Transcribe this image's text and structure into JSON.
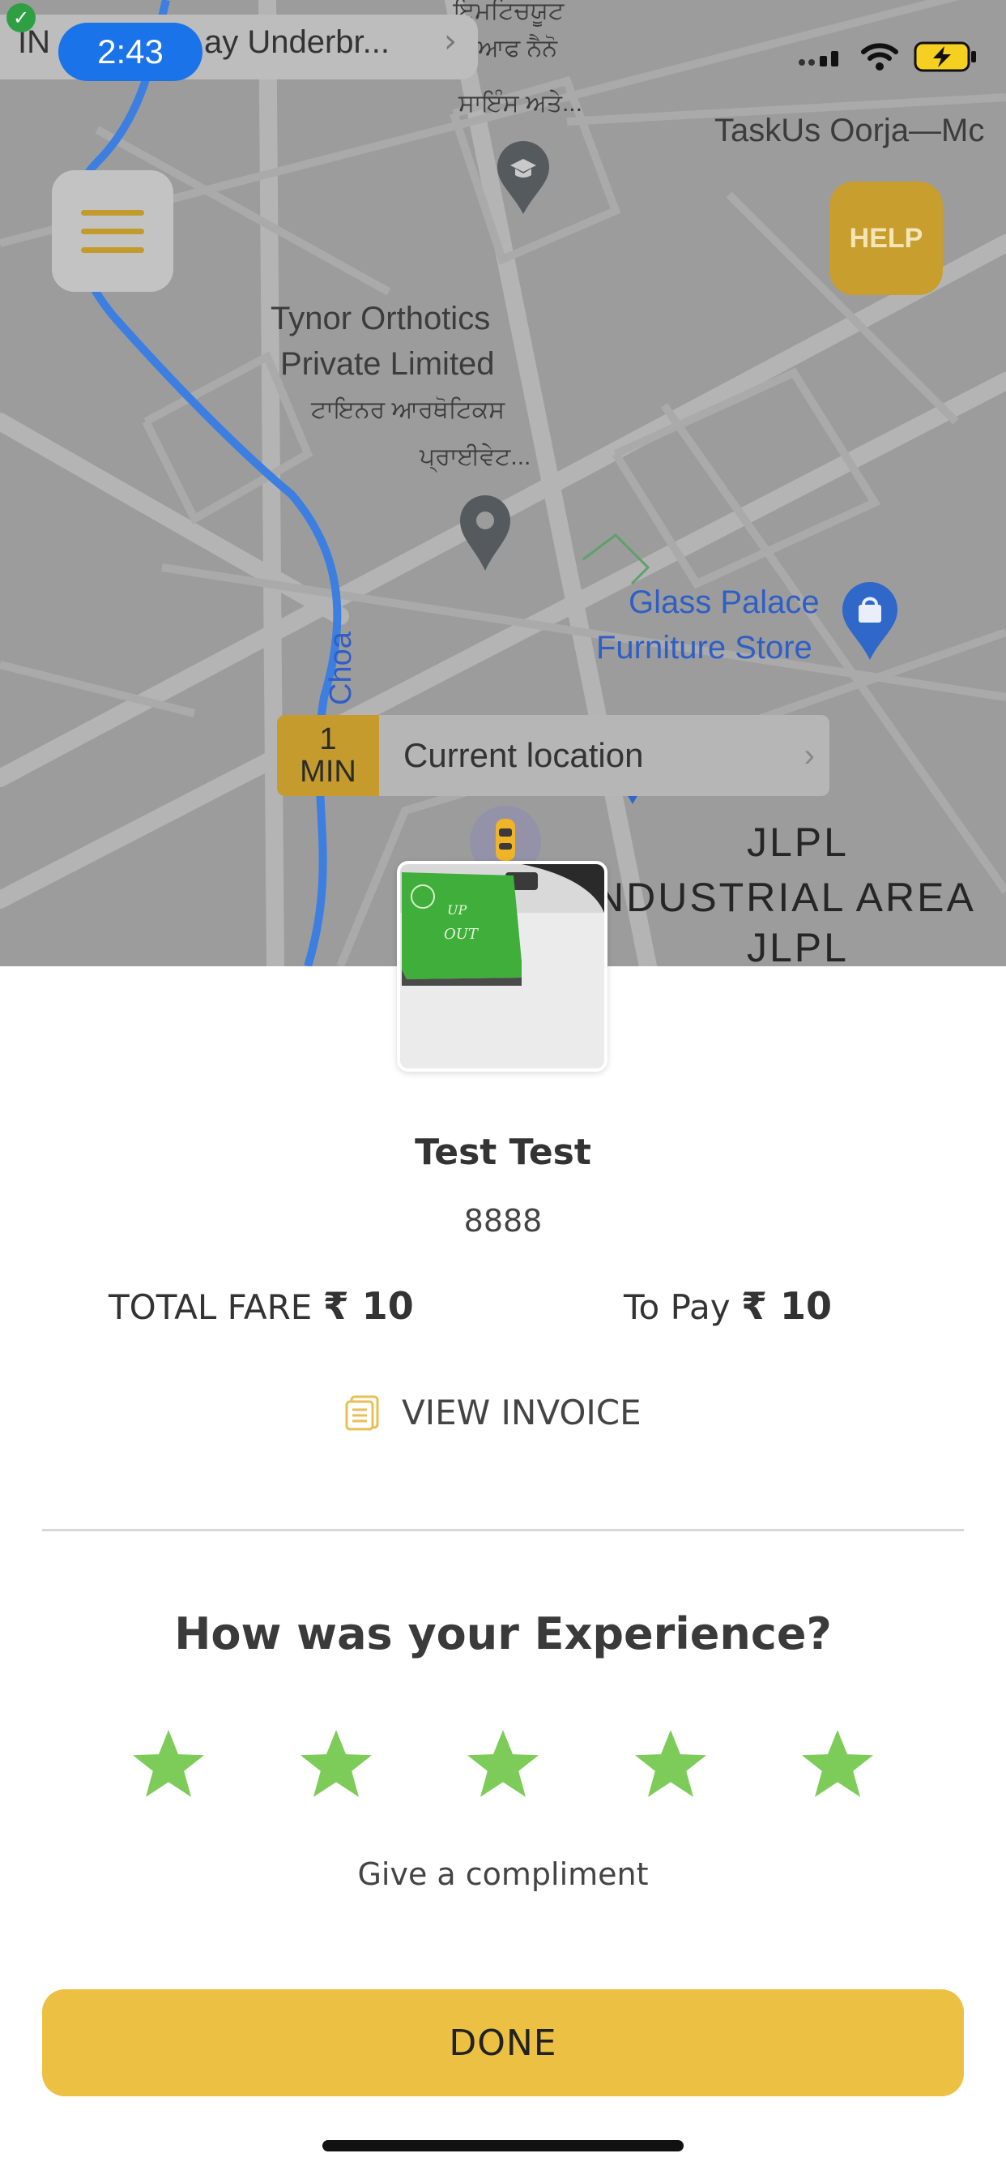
{
  "status_bar": {
    "time": "2:43",
    "nav_prefix": "IN",
    "nav_destination": "ay Underbr...",
    "nav_chevron_icon": "chevron-right-icon",
    "check_icon": "check-icon",
    "signal_icon": "cellular-signal-icon",
    "wifi_icon": "wifi-icon",
    "battery_icon": "battery-charging-icon"
  },
  "map": {
    "labels": {
      "punjabi_top_1": "ਇਮਟਿਚਯੂਟ",
      "punjabi_top_2": "ਆਫ ਨੈਨੋ",
      "punjabi_top_3": "ਸਾਇੰਸ ਅਤੇ...",
      "taskus": "TaskUs Oorja—Mc",
      "tynor_1": "Tynor Orthotics",
      "tynor_2": "Private Limited",
      "tynor_3": "ਟਾਇਨਰ ਆਰਥੋਟਿਕਸ",
      "tynor_4": "ਪ੍ਰਾਈਵੇਟ...",
      "glass_1": "Glass Palace",
      "glass_2": "Furniture Store",
      "choa": "Choa",
      "jlpl_1": "JLPL",
      "industrial": "NDUSTRIAL AREA",
      "jlpl_2": "JLPL"
    },
    "menu_icon": "hamburger-menu-icon",
    "help_label": "HELP",
    "eta": {
      "value": "1",
      "unit": "MIN",
      "label": "Current location"
    }
  },
  "trip": {
    "photo_text_1": "UP",
    "photo_text_2": "OUT",
    "customer_name": "Test Test",
    "customer_code": "8888",
    "total_fare_label": "TOTAL FARE",
    "total_fare_value": "₹ 10",
    "to_pay_label": "To Pay",
    "to_pay_value": "₹ 10",
    "invoice_icon": "invoice-document-icon",
    "invoice_label": "VIEW INVOICE"
  },
  "rating": {
    "title": "How was your Experience?",
    "stars_filled": 5,
    "stars_total": 5,
    "star_color": "#7dcc5a",
    "compliment_label": "Give a compliment"
  },
  "actions": {
    "done_label": "DONE",
    "done_color": "#ecc143"
  },
  "colors": {
    "map_bg": "#9c9c9c",
    "accent_gold": "#c49b2c",
    "route_blue": "#3d7fe0"
  }
}
